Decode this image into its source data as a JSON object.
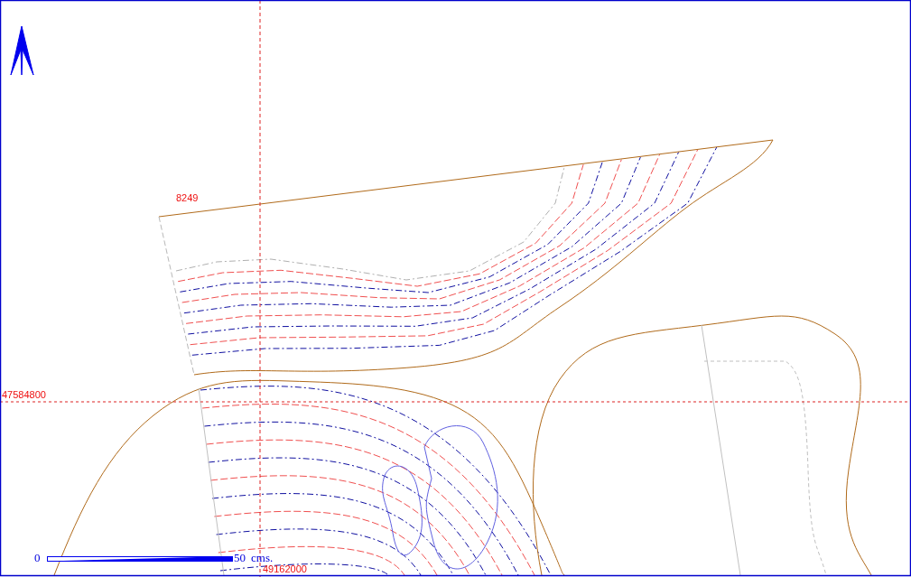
{
  "map": {
    "parcel_label": "8249",
    "northing_label": "47584800",
    "easting_label": "49162000"
  },
  "scale_bar": {
    "start": "0",
    "end": "50",
    "unit": "cms."
  }
}
